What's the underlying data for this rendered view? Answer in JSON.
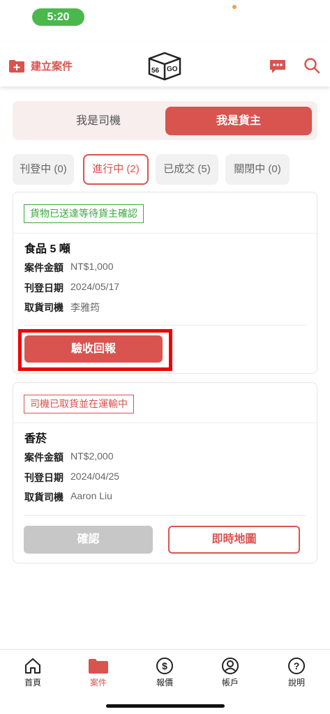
{
  "status_bar": {
    "time": "5:20"
  },
  "header": {
    "create_case_label": "建立案件",
    "logo_text": "56GO"
  },
  "role_switch": {
    "driver": "我是司機",
    "owner": "我是貨主",
    "selected": "owner"
  },
  "filters": [
    {
      "label": "刊登中 (0)"
    },
    {
      "label": "進行中 (2)"
    },
    {
      "label": "已成交 (5)"
    },
    {
      "label": "關閉中 (0)"
    }
  ],
  "cards": [
    {
      "status": "貨物已送達等待貨主確認",
      "goods": "食品 5 噸",
      "fields": [
        {
          "key": "案件金額",
          "value": "NT$1,000"
        },
        {
          "key": "刊登日期",
          "value": "2024/05/17"
        },
        {
          "key": "取貨司機",
          "value": "李雅筠"
        }
      ],
      "primary_button": "驗收回報"
    },
    {
      "status": "司機已取貨並在運輸中",
      "goods": "香菸",
      "fields": [
        {
          "key": "案件金額",
          "value": "NT$2,000"
        },
        {
          "key": "刊登日期",
          "value": "2024/04/25"
        },
        {
          "key": "取貨司機",
          "value": "Aaron Liu"
        }
      ],
      "confirm_button": "確認",
      "map_button": "即時地圖"
    }
  ],
  "tabbar": [
    {
      "label": "首頁",
      "icon": "home-icon"
    },
    {
      "label": "案件",
      "icon": "folder-icon"
    },
    {
      "label": "報價",
      "icon": "dollar-icon"
    },
    {
      "label": "帳戶",
      "icon": "user-icon"
    },
    {
      "label": "說明",
      "icon": "help-icon"
    }
  ],
  "colors": {
    "accent": "#d9534f",
    "status_green": "#3aa83e",
    "highlight": "#ee0000"
  }
}
